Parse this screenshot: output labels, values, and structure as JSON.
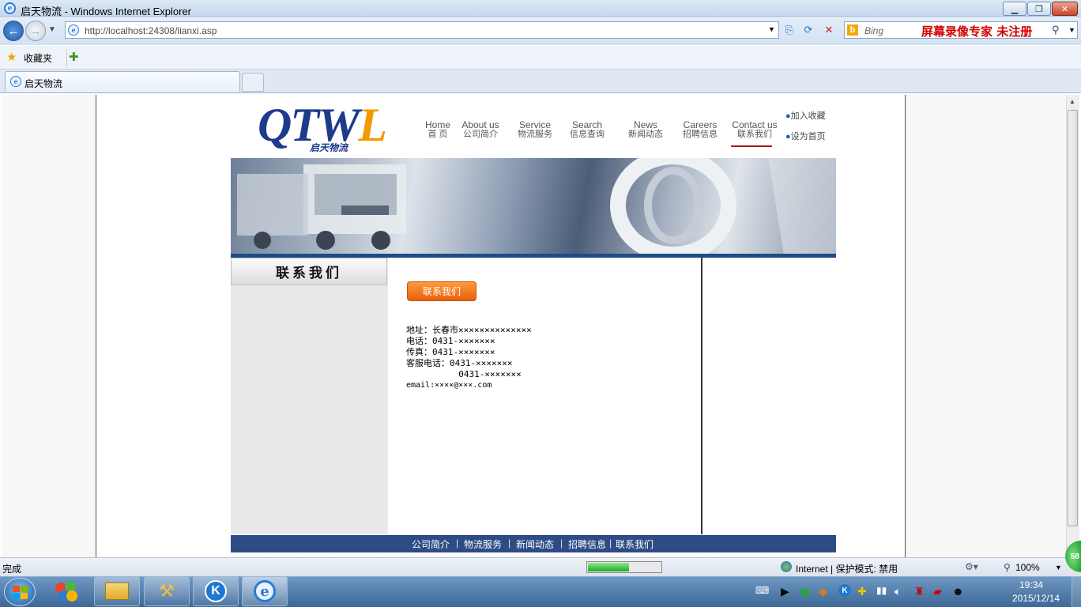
{
  "window": {
    "title": "启天物流 - Windows Internet Explorer"
  },
  "address_bar": {
    "url": "http://localhost:24308/lianxi.asp"
  },
  "search": {
    "placeholder": "Bing",
    "watermark": "屏幕录像专家  未注册"
  },
  "favorites": {
    "label": "收藏夹"
  },
  "tabs": [
    {
      "label": "启天物流"
    }
  ],
  "site": {
    "logo_text": "QTWL",
    "logo_sub": "启天物流",
    "nav": [
      {
        "en": "Home",
        "zh": "首  页"
      },
      {
        "en": "About us",
        "zh": "公司简介"
      },
      {
        "en": "Service",
        "zh": "物流服务"
      },
      {
        "en": "Search",
        "zh": "信息查询"
      },
      {
        "en": "News",
        "zh": "新闻动态"
      },
      {
        "en": "Careers",
        "zh": "招聘信息"
      },
      {
        "en": "Contact us",
        "zh": "联系我们"
      }
    ],
    "side_links": [
      "加入收藏",
      "设为首页"
    ],
    "sidebar_title": "联系我们",
    "contact_button": "联系我们",
    "contact_lines": [
      "地址：长春市××××××××××××××",
      "电话：0431-×××××××",
      "传真：0431-×××××××",
      "客服电话：0431-×××××××",
      "          0431-×××××××",
      "email:××××@×××.com"
    ],
    "footer_links": [
      "公司简介",
      "物流服务",
      "新闻动态",
      "招聘信息",
      "联系我们"
    ]
  },
  "status": {
    "text": "完成",
    "zone": "Internet | 保护模式: 禁用",
    "zoom": "100%"
  },
  "taskbar": {
    "time": "19:34",
    "date": "2015/12/14",
    "badge": "58"
  }
}
